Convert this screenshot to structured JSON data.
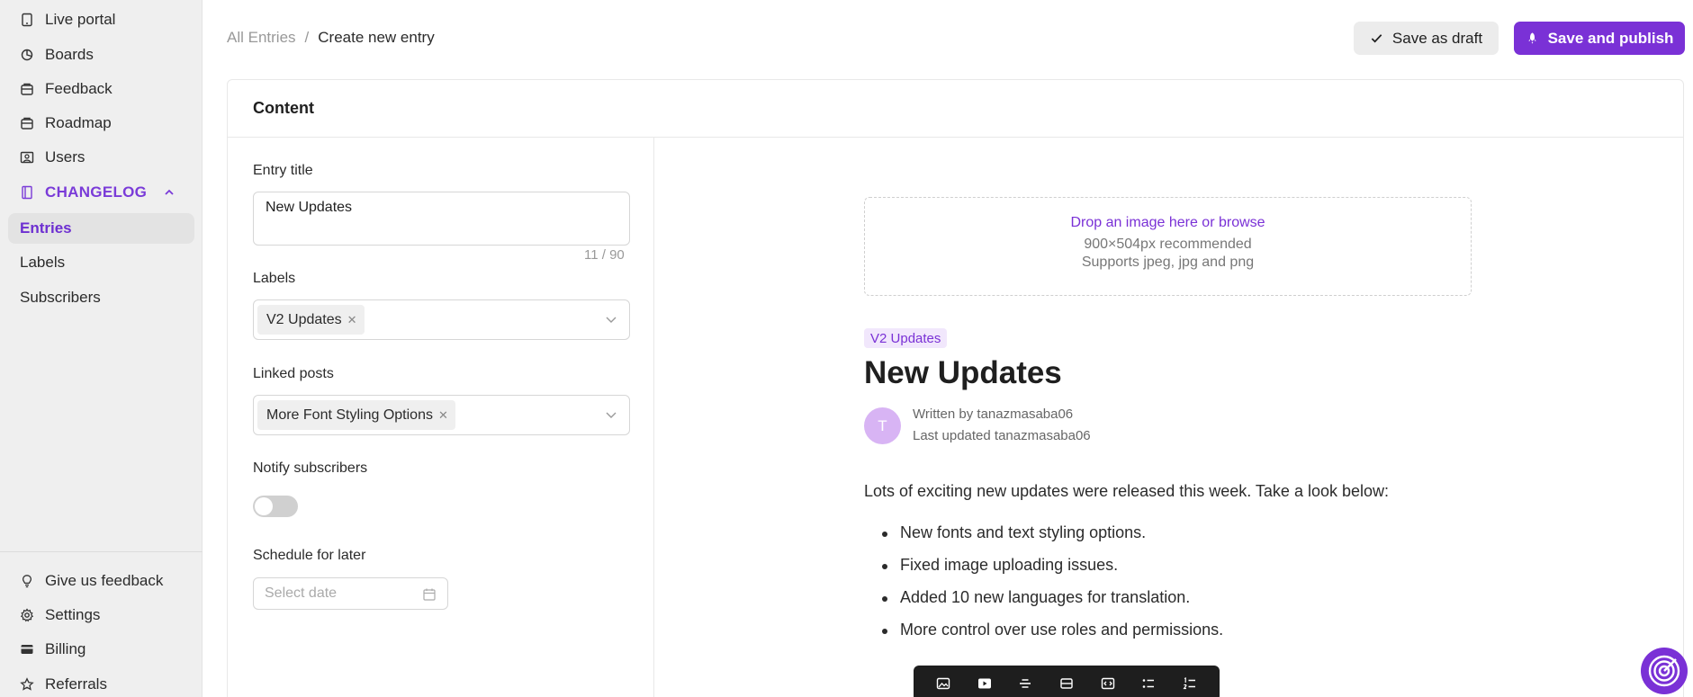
{
  "sidebar": {
    "top_items": [
      {
        "label": "Live portal",
        "icon": "tablet-icon"
      },
      {
        "label": "Boards",
        "icon": "boards-icon"
      },
      {
        "label": "Feedback",
        "icon": "feedback-icon"
      },
      {
        "label": "Roadmap",
        "icon": "roadmap-icon"
      },
      {
        "label": "Users",
        "icon": "users-icon"
      }
    ],
    "section": {
      "label": "CHANGELOG",
      "icon": "changelog-icon"
    },
    "sub_items": [
      {
        "label": "Entries",
        "active": true
      },
      {
        "label": "Labels",
        "active": false
      },
      {
        "label": "Subscribers",
        "active": false
      }
    ],
    "bottom_items": [
      {
        "label": "Give us feedback",
        "icon": "lightbulb-icon"
      },
      {
        "label": "Settings",
        "icon": "gear-icon"
      },
      {
        "label": "Billing",
        "icon": "credit-card-icon"
      },
      {
        "label": "Referrals",
        "icon": "star-icon"
      }
    ]
  },
  "breadcrumb": {
    "parent": "All Entries",
    "separator": "/",
    "current": "Create new entry"
  },
  "actions": {
    "draft_label": "Save as draft",
    "publish_label": "Save and publish"
  },
  "card": {
    "title": "Content"
  },
  "form": {
    "title_label": "Entry title",
    "title_value": "New Updates",
    "title_counter": "11 / 90",
    "labels_label": "Labels",
    "labels_selected": "V2 Updates",
    "linked_label": "Linked posts",
    "linked_selected": "More Font Styling Options",
    "notify_label": "Notify subscribers",
    "notify_on": false,
    "schedule_label": "Schedule for later",
    "date_placeholder": "Select date"
  },
  "preview": {
    "drop_link": "Drop an image here or browse",
    "drop_size": "900×504px recommended",
    "drop_formats": "Supports jpeg, jpg and png",
    "label_chip": "V2 Updates",
    "title": "New Updates",
    "avatar_initial": "T",
    "written_by": "Written by tanazmasaba06",
    "last_updated": "Last updated tanazmasaba06",
    "intro": "Lots of exciting new updates were released this week. Take a look below:",
    "bullets": [
      "New fonts and text styling options.",
      "Fixed image uploading issues.",
      "Added 10 new languages for translation.",
      "More control over use roles and permissions."
    ]
  },
  "toolbar": {
    "icons": [
      "image-icon",
      "video-icon",
      "strikethrough-icon",
      "divider-icon",
      "code-embed-icon",
      "bullet-list-icon",
      "numbered-list-icon"
    ]
  },
  "colors": {
    "accent": "#7a31d6",
    "sidebar_bg": "#efefef",
    "chip_bg": "#f1e7fc"
  }
}
